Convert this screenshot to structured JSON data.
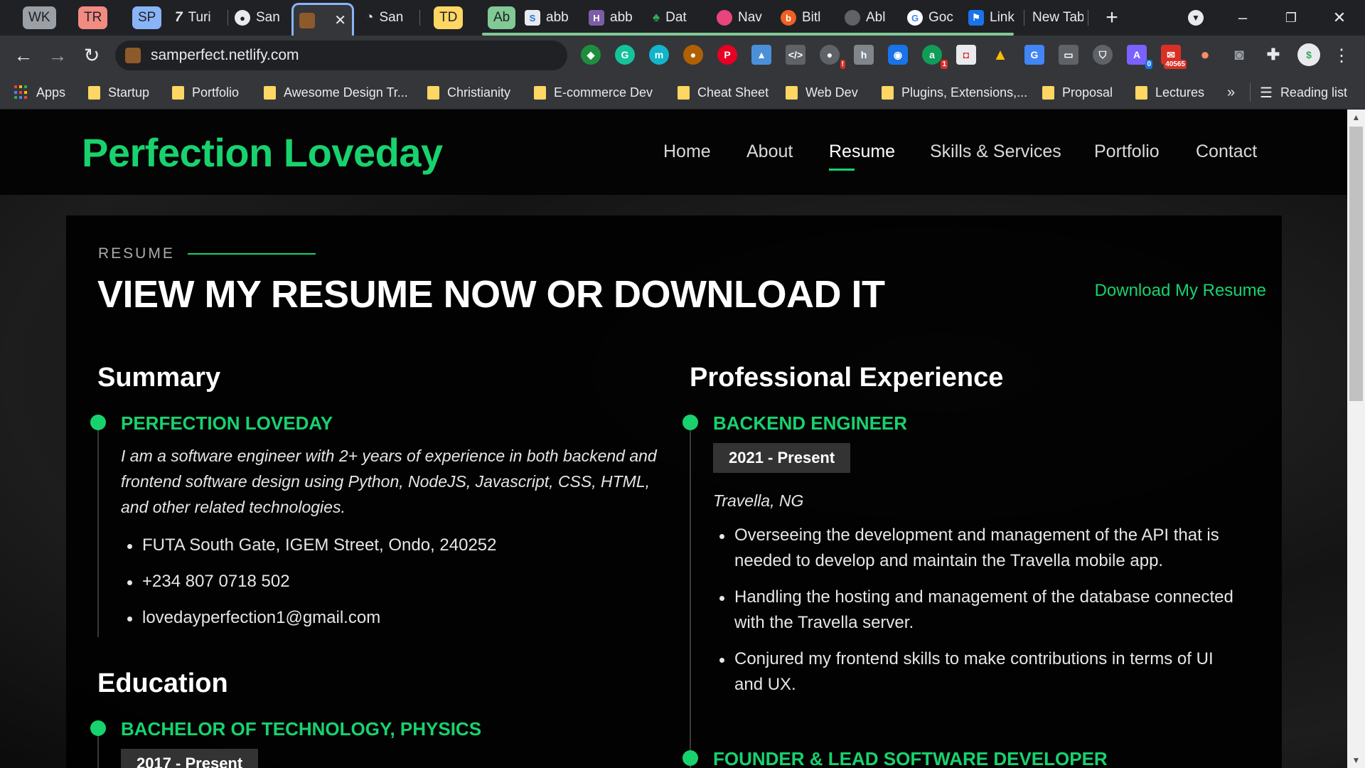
{
  "browser": {
    "tabs": [
      {
        "label": "WK",
        "kind": "chip",
        "color": "#9aa0a6"
      },
      {
        "label": "TR",
        "kind": "chip",
        "color": "#f28b82"
      },
      {
        "label": "SP",
        "kind": "chip",
        "color": "#8ab4f8"
      },
      {
        "label": "Turi"
      },
      {
        "label": "San"
      },
      {
        "label": "",
        "active": true
      },
      {
        "label": "San"
      },
      {
        "label": "TD",
        "kind": "chip",
        "color": "#fdd663"
      },
      {
        "label": "Ab",
        "kind": "chip",
        "color": "#81c995"
      },
      {
        "label": "abb"
      },
      {
        "label": "abb"
      },
      {
        "label": "Dat"
      },
      {
        "label": "Nav"
      },
      {
        "label": "Bitl"
      },
      {
        "label": "Abl"
      },
      {
        "label": "Goc"
      },
      {
        "label": "Link"
      },
      {
        "label": "New Tab"
      }
    ],
    "url": "samperfect.netlify.com",
    "extension_badges": {
      "notifications": "1",
      "mail_count": "40565",
      "account_count": "0"
    },
    "bookmarks": [
      "Apps",
      "Startup",
      "Portfolio",
      "Awesome Design Tr...",
      "Christianity",
      "E-commerce Dev",
      "Cheat Sheet",
      "Web Dev",
      "Plugins, Extensions,...",
      "Proposal",
      "Lectures"
    ],
    "bookmarks_overflow": "»",
    "reading_list": "Reading list"
  },
  "site": {
    "logo": "Perfection Loveday",
    "nav": [
      "Home",
      "About",
      "Resume",
      "Skills & Services",
      "Portfolio",
      "Contact"
    ],
    "active_nav": "Resume",
    "accent_color": "#18d26e"
  },
  "resume": {
    "kicker": "RESUME",
    "title": "VIEW MY RESUME NOW OR DOWNLOAD IT",
    "download_label": "Download My Resume",
    "summary": {
      "heading": "Summary",
      "name": "PERFECTION LOVEDAY",
      "bio": "I am a software engineer with 2+ years of experience in both backend and frontend software design using Python, NodeJS, Javascript, CSS, HTML, and other related technologies.",
      "contacts": [
        "FUTA South Gate, IGEM Street, Ondo, 240252",
        "+234 807 0718 502",
        "lovedayperfection1@gmail.com"
      ]
    },
    "education": {
      "heading": "Education",
      "degree": "BACHELOR OF TECHNOLOGY, PHYSICS",
      "dates": "2017 - Present"
    },
    "experience": {
      "heading": "Professional Experience",
      "jobs": [
        {
          "title": "BACKEND ENGINEER",
          "dates": "2021 - Present",
          "location": "Travella, NG",
          "duties": [
            "Overseeing the development and management of the API that is needed to develop and maintain the Travella mobile app.",
            "Handling the hosting and management of the database connected with the Travella server.",
            "Conjured my frontend skills to make contributions in terms of UI and UX."
          ]
        },
        {
          "title": "FOUNDER & LEAD SOFTWARE DEVELOPER"
        }
      ]
    }
  }
}
